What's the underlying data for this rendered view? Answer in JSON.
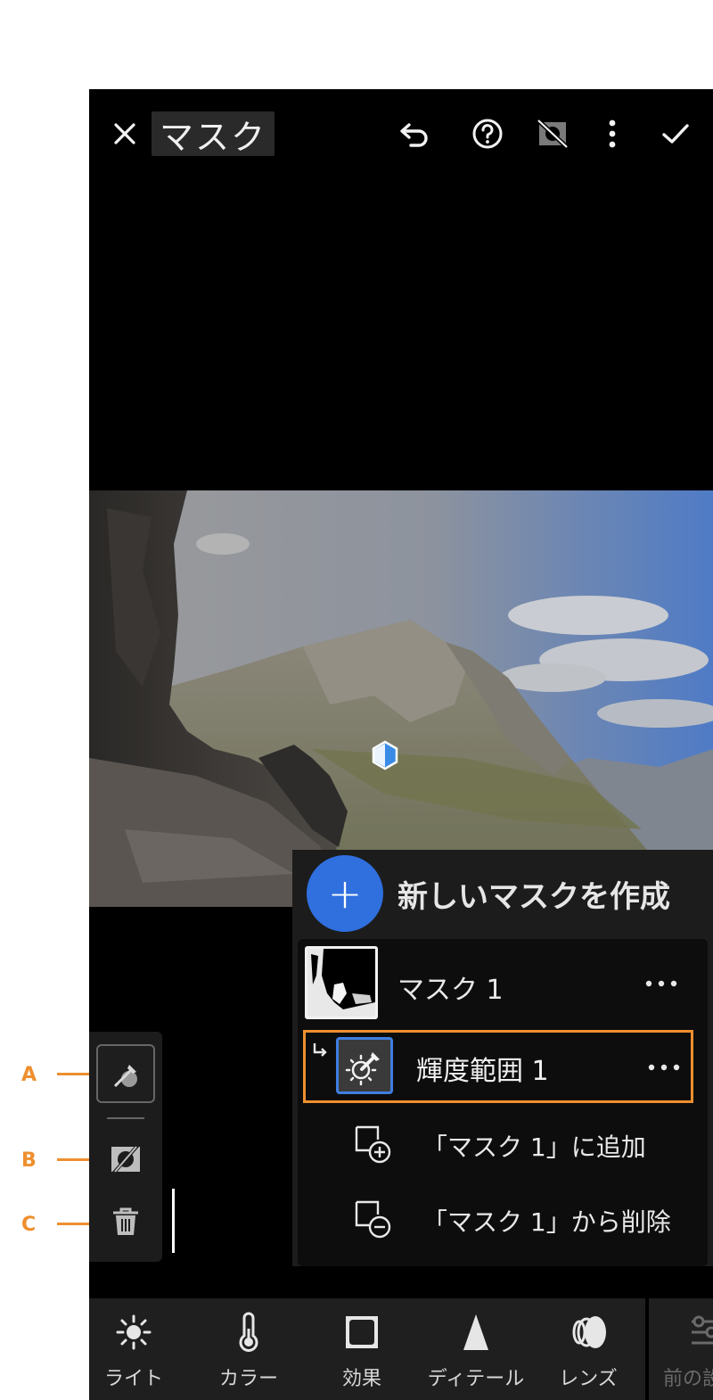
{
  "header": {
    "title": "マスク",
    "icons": [
      "close-icon",
      "undo-icon",
      "help-icon",
      "mask-overlay-toggle-icon",
      "more-vertical-icon",
      "check-icon"
    ]
  },
  "panel": {
    "create_label": "新しいマスクを作成",
    "create_symbol": "+",
    "mask_name": "マスク 1",
    "component_name": "輝度範囲 1",
    "add_label": "「マスク 1」に追加",
    "subtract_label": "「マスク 1」から削除"
  },
  "bottom_tabs": [
    {
      "label": "ライト",
      "icon": "sun-icon"
    },
    {
      "label": "カラー",
      "icon": "thermometer-icon"
    },
    {
      "label": "効果",
      "icon": "vignette-icon"
    },
    {
      "label": "ディテール",
      "icon": "detail-triangle-icon"
    },
    {
      "label": "レンズ",
      "icon": "lens-icon"
    }
  ],
  "prev_label": "前の設",
  "callouts": [
    "A",
    "B",
    "C"
  ],
  "colors": {
    "accent_orange": "#ee8f2f",
    "accent_blue": "#2f6fde",
    "panel_bg": "#1c1c1c"
  }
}
